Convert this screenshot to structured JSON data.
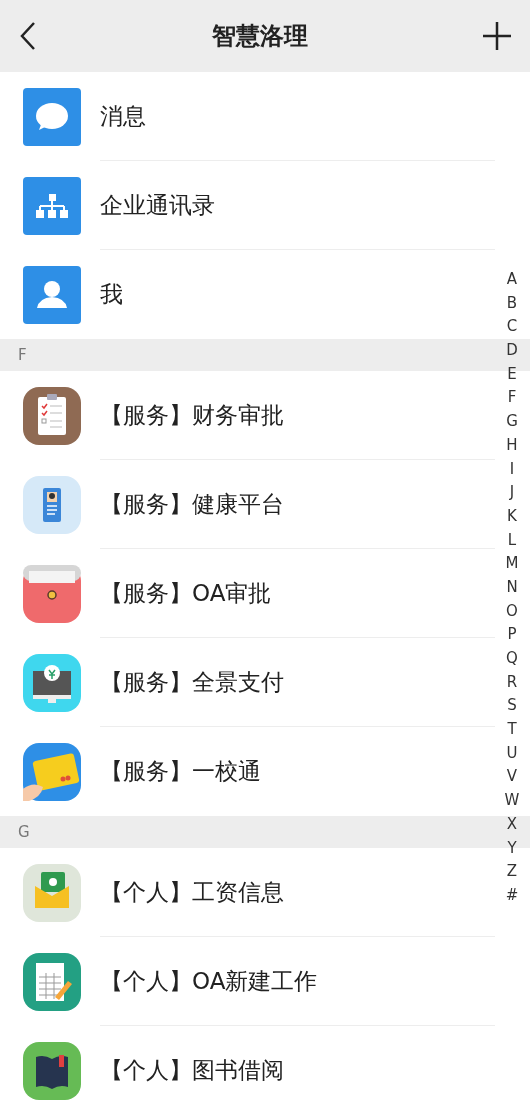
{
  "header": {
    "title": "智慧洛理"
  },
  "top_items": [
    {
      "label": "消息"
    },
    {
      "label": "企业通讯录"
    },
    {
      "label": "我"
    }
  ],
  "sections": [
    {
      "letter": "F",
      "items": [
        {
          "label": "【服务】财务审批"
        },
        {
          "label": "【服务】健康平台"
        },
        {
          "label": "【服务】OA审批"
        },
        {
          "label": "【服务】全景支付"
        },
        {
          "label": "【服务】一校通"
        }
      ]
    },
    {
      "letter": "G",
      "items": [
        {
          "label": "【个人】工资信息"
        },
        {
          "label": "【个人】OA新建工作"
        },
        {
          "label": "【个人】图书借阅"
        }
      ]
    }
  ],
  "index": [
    "A",
    "B",
    "C",
    "D",
    "E",
    "F",
    "G",
    "H",
    "I",
    "J",
    "K",
    "L",
    "M",
    "N",
    "O",
    "P",
    "Q",
    "R",
    "S",
    "T",
    "U",
    "V",
    "W",
    "X",
    "Y",
    "Z",
    "#"
  ]
}
